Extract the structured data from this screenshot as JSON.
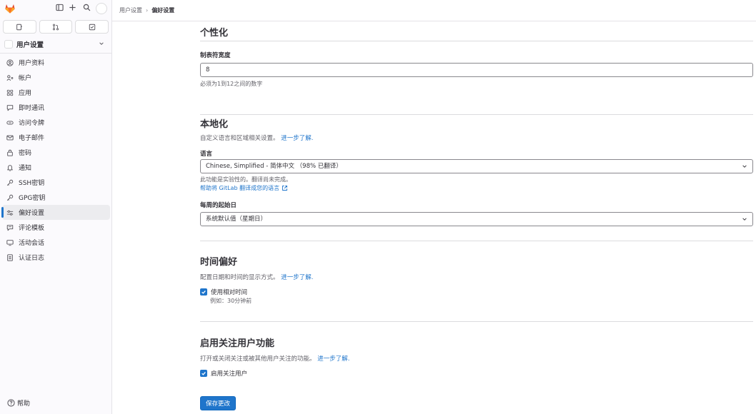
{
  "sidebar": {
    "context_label": "用户设置",
    "items": [
      {
        "label": "用户资料",
        "icon": "user-icon"
      },
      {
        "label": "帐户",
        "icon": "account-icon"
      },
      {
        "label": "应用",
        "icon": "applications-icon"
      },
      {
        "label": "即时通讯",
        "icon": "chat-icon"
      },
      {
        "label": "访问令牌",
        "icon": "token-icon"
      },
      {
        "label": "电子邮件",
        "icon": "mail-icon"
      },
      {
        "label": "密码",
        "icon": "lock-icon"
      },
      {
        "label": "通知",
        "icon": "bell-icon"
      },
      {
        "label": "SSH密钥",
        "icon": "key-icon"
      },
      {
        "label": "GPG密钥",
        "icon": "key-icon"
      },
      {
        "label": "偏好设置",
        "icon": "preferences-icon",
        "active": true
      },
      {
        "label": "评论模板",
        "icon": "comment-template-icon"
      },
      {
        "label": "活动会话",
        "icon": "monitor-icon"
      },
      {
        "label": "认证日志",
        "icon": "log-icon"
      }
    ],
    "help_label": "帮助"
  },
  "breadcrumb": {
    "parent": "用户设置",
    "current": "偏好设置"
  },
  "personalization": {
    "title": "个性化",
    "tab_width_label": "制表符宽度",
    "tab_width_value": "8",
    "tab_width_help": "必须为1到12之间的数字"
  },
  "localization": {
    "title": "本地化",
    "description": "自定义语言和区域相关设置。",
    "learn_more": "进一步了解.",
    "language_label": "语言",
    "language_value": "Chinese, Simplified - 简体中文 （98% 已翻译）",
    "language_help": "此功能是实验性的。翻译尚未完成。",
    "translate_link": "帮助将 GitLab 翻译成您的语言",
    "week_start_label": "每周的起始日",
    "week_start_value": "系统默认值（星期日）"
  },
  "time": {
    "title": "时间偏好",
    "description": "配置日期和时间的显示方式。",
    "learn_more": "进一步了解.",
    "relative_time_label": "使用相对时间",
    "relative_time_example": "例如：30分钟前"
  },
  "follow": {
    "title": "启用关注用户功能",
    "description": "打开或关闭关注或被其他用户关注的功能。",
    "learn_more": "进一步了解.",
    "enable_label": "启用关注用户"
  },
  "save_label": "保存更改",
  "colors": {
    "accent": "#1f75cb",
    "logo": "#e24329"
  }
}
